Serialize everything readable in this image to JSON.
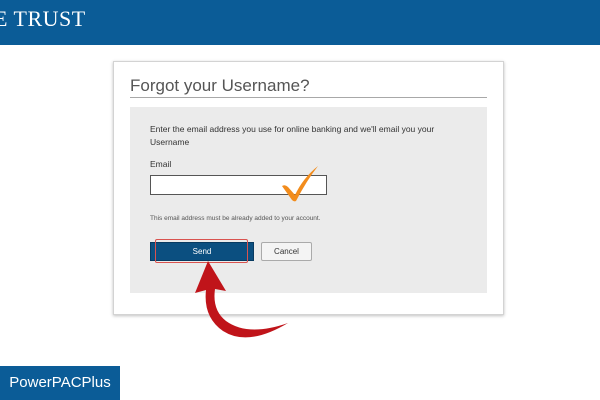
{
  "header": {
    "brand": "E TRUST"
  },
  "form": {
    "title": "Forgot your Username?",
    "instructions": "Enter the email address you use for online banking and we'll email you your Username",
    "email_label": "Email",
    "email_value": "",
    "note": "This email address must be already added to your account.",
    "send_label": "Send",
    "cancel_label": "Cancel"
  },
  "annotations": {
    "checkmark_color": "#f28c1c",
    "arrow_color": "#c0141a",
    "highlight_color": "#d9534f"
  },
  "footer": {
    "badge": "PowerPACPlus"
  },
  "colors": {
    "brand_blue": "#0b5c97",
    "button_blue": "#0b4f80",
    "panel_gray": "#ebebeb"
  }
}
